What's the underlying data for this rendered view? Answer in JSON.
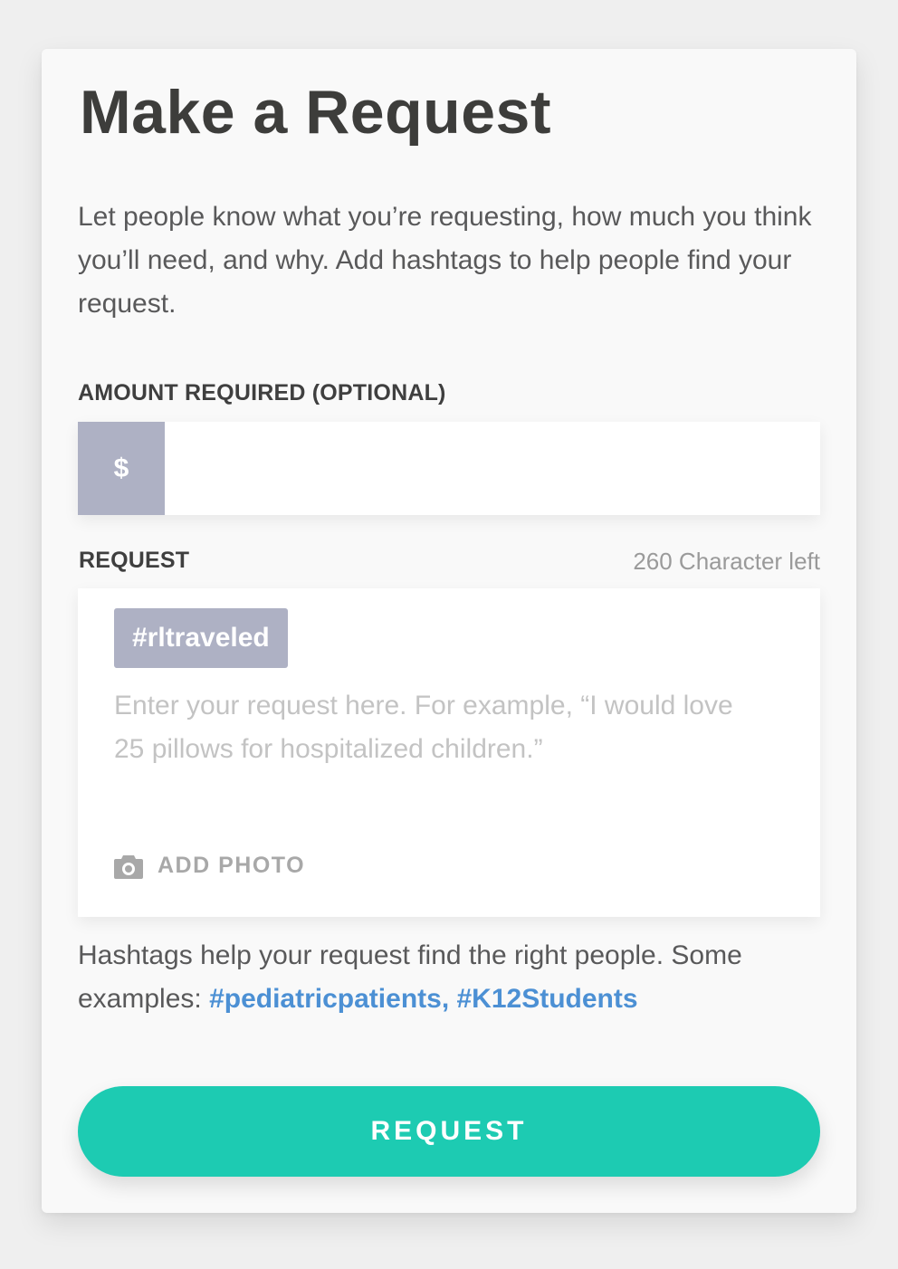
{
  "page": {
    "title": "Make a Request",
    "intro": "Let people know what you’re requesting, how much you think you’ll need, and why. Add hashtags to help people find your request."
  },
  "amount": {
    "label": "AMOUNT REQUIRED (OPTIONAL)",
    "currency_symbol": "$",
    "value": ""
  },
  "request": {
    "label": "REQUEST",
    "char_count_text": "260 Character left",
    "hashtag": "#rltraveled",
    "placeholder": "Enter your request here. For example, “I would love 25 pillows for hospitalized children.”",
    "value": "",
    "add_photo_label": "ADD PHOTO",
    "add_photo_icon": "camera-icon"
  },
  "helper": {
    "text": "Hashtags help your request find the right people. Some examples: ",
    "examples": "#pediatricpatients, #K12Students"
  },
  "submit": {
    "label": "REQUEST"
  },
  "colors": {
    "background": "#efefef",
    "card": "#f9f9f9",
    "accent": "#1dcbb2",
    "chip": "#aeb1c4",
    "link": "#4c90d4"
  }
}
